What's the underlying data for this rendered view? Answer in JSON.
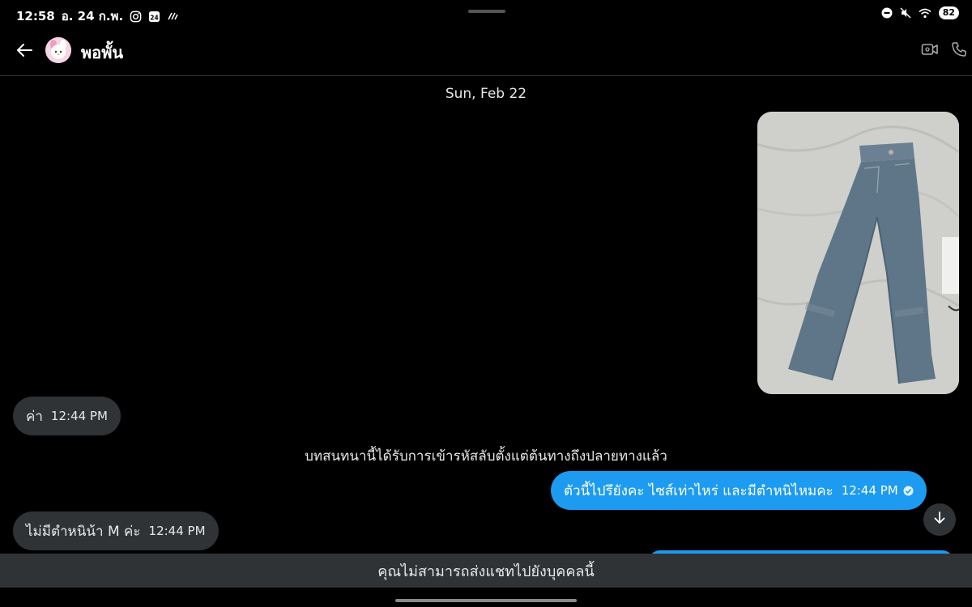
{
  "status_bar": {
    "time": "12:58",
    "date": "อ. 24 ก.พ.",
    "calendar_badge": "24",
    "battery": "82",
    "icons": [
      "instagram-icon",
      "calendar-icon",
      "signal-lines-icon",
      "do-not-disturb-icon",
      "mute-icon",
      "wifi-icon",
      "battery-icon"
    ]
  },
  "header": {
    "contact_name": "พอพั้น",
    "back_icon": "arrow-left-icon",
    "video_icon": "video-call-icon",
    "call_icon": "phone-icon"
  },
  "messages": {
    "date_separator": "Sun, Feb 22",
    "photo": {
      "alt": "jeans-photo",
      "colors": {
        "background": "#cfd0cc",
        "denim": "#5f7688"
      }
    },
    "incoming_1": {
      "text": "ค่า",
      "time": "12:44 PM"
    },
    "system_note": "บทสนทนานี้ได้รับการเข้ารหัสลับตั้งแต่ต้นทางถึงปลายทางแล้ว",
    "outgoing_1": {
      "text": "ตัวนี้ไปรึยังคะ ไซส์เท่าไหร่ และมีตำหนิไหมคะ",
      "time": "12:44 PM"
    },
    "incoming_2": {
      "text": "ไม่มีตำหนิน้า M ค่ะ",
      "time": "12:44 PM"
    }
  },
  "footer": {
    "disabled_notice": "คุณไม่สามารถส่งแชทไปยังบุคคลนี้"
  },
  "colors": {
    "background": "#000000",
    "outgoing_bubble": "#1d9bf0",
    "incoming_bubble": "#2f3336",
    "text": "#e7e9ea"
  }
}
